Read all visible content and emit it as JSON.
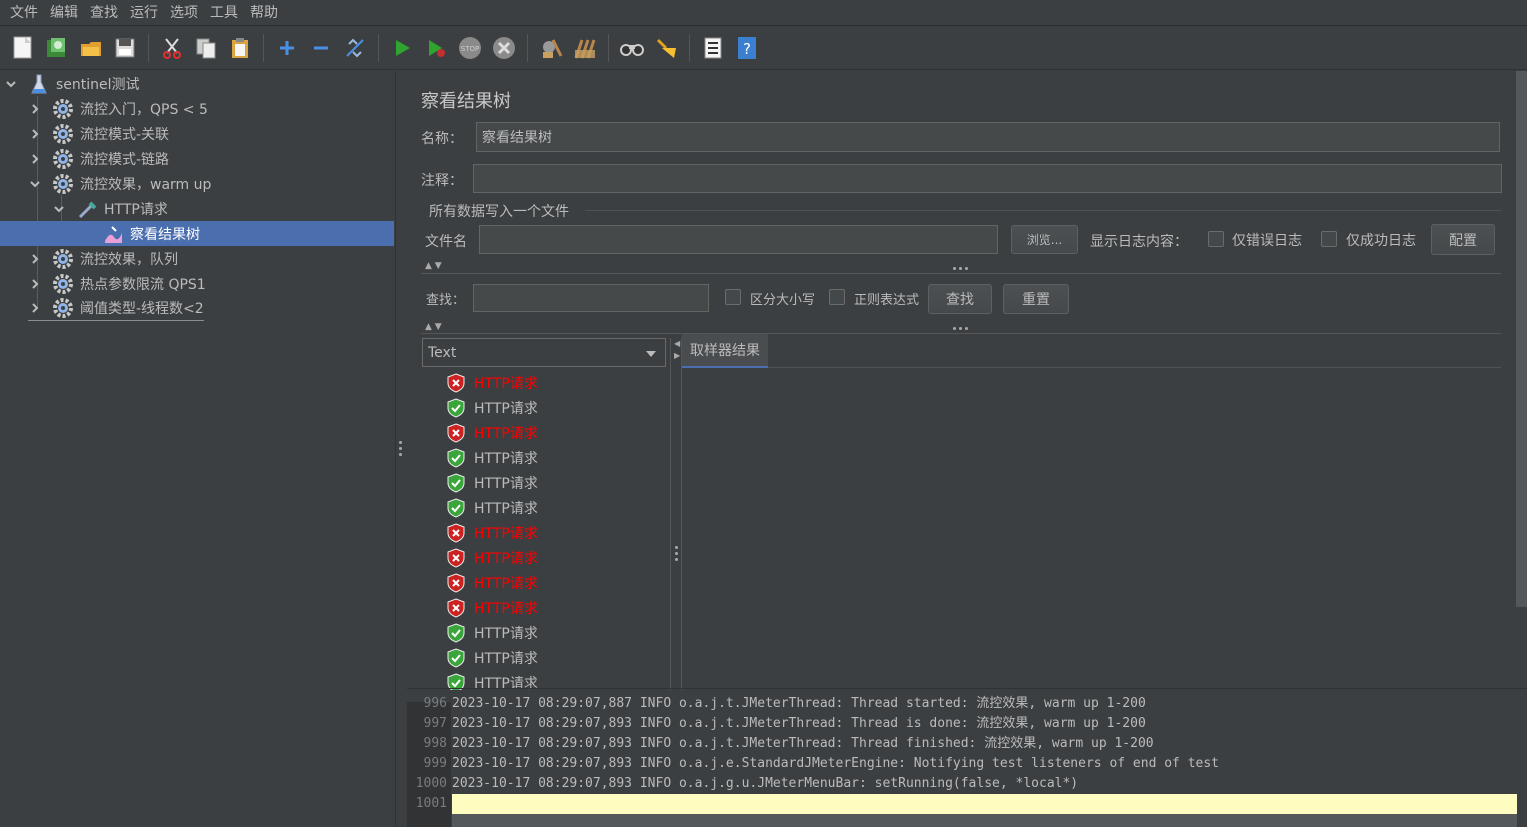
{
  "menu": [
    "文件",
    "编辑",
    "查找",
    "运行",
    "选项",
    "工具",
    "帮助"
  ],
  "toolbar": [
    "new-icon",
    "templates-icon",
    "open-icon",
    "save-icon",
    "cut-icon",
    "copy-icon",
    "paste-icon",
    "expand-icon",
    "collapse-icon",
    "toggle-icon",
    "start-icon",
    "start-no-pause-icon",
    "stop-icon",
    "shutdown-icon",
    "clear-icon",
    "clear-all-icon",
    "search-icon",
    "reset-search-icon",
    "function-helper-icon",
    "help-icon"
  ],
  "tree": {
    "root": "sentinel测试",
    "items": [
      {
        "label": "流控入门，QPS < 5"
      },
      {
        "label": "流控模式-关联"
      },
      {
        "label": "流控模式-链路"
      },
      {
        "label": "流控效果，warm up"
      },
      {
        "label": "HTTP请求"
      },
      {
        "label": "察看结果树"
      },
      {
        "label": "流控效果，队列"
      },
      {
        "label": "热点参数限流 QPS1"
      },
      {
        "label": "阈值类型-线程数<2"
      }
    ]
  },
  "panel": {
    "title": "察看结果树",
    "name_label": "名称：",
    "name_value": "察看结果树",
    "comment_label": "注释：",
    "comment_value": "",
    "file_section": "所有数据写入一个文件",
    "filename_label": "文件名",
    "filename_value": "",
    "browse": "浏览...",
    "log_label": "显示日志内容：",
    "errors_only": "仅错误日志",
    "success_only": "仅成功日志",
    "configure": "配置",
    "search_label": "查找：",
    "search_value": "",
    "case_sensitive": "区分大小写",
    "regex": "正则表达式",
    "find": "查找",
    "reset": "重置",
    "renderer": "Text",
    "tab": "取样器结果"
  },
  "results": [
    {
      "label": "HTTP请求",
      "status": "error"
    },
    {
      "label": "HTTP请求",
      "status": "ok"
    },
    {
      "label": "HTTP请求",
      "status": "error"
    },
    {
      "label": "HTTP请求",
      "status": "ok"
    },
    {
      "label": "HTTP请求",
      "status": "ok"
    },
    {
      "label": "HTTP请求",
      "status": "ok"
    },
    {
      "label": "HTTP请求",
      "status": "error"
    },
    {
      "label": "HTTP请求",
      "status": "error"
    },
    {
      "label": "HTTP请求",
      "status": "error"
    },
    {
      "label": "HTTP请求",
      "status": "error"
    },
    {
      "label": "HTTP请求",
      "status": "ok"
    },
    {
      "label": "HTTP请求",
      "status": "ok"
    },
    {
      "label": "HTTP请求",
      "status": "ok"
    }
  ],
  "log": [
    {
      "n": "996",
      "t": "2023-10-17 08:29:07,887 INFO o.a.j.t.JMeterThread: Thread started: 流控效果, warm up 1-200"
    },
    {
      "n": "997",
      "t": "2023-10-17 08:29:07,893 INFO o.a.j.t.JMeterThread: Thread is done: 流控效果, warm up 1-200"
    },
    {
      "n": "998",
      "t": "2023-10-17 08:29:07,893 INFO o.a.j.t.JMeterThread: Thread finished: 流控效果, warm up 1-200"
    },
    {
      "n": "999",
      "t": "2023-10-17 08:29:07,893 INFO o.a.j.e.StandardJMeterEngine: Notifying test listeners of end of test"
    },
    {
      "n": "1000",
      "t": "2023-10-17 08:29:07,893 INFO o.a.j.g.u.JMeterMenuBar: setRunning(false, *local*)"
    },
    {
      "n": "1001",
      "t": ""
    }
  ],
  "colors": {
    "selected": "#4b6eaf",
    "error_text": "#ff0000",
    "ok_icon": "#3aa53a",
    "error_icon": "#cc2222",
    "log_highlight": "#fffcbf"
  }
}
